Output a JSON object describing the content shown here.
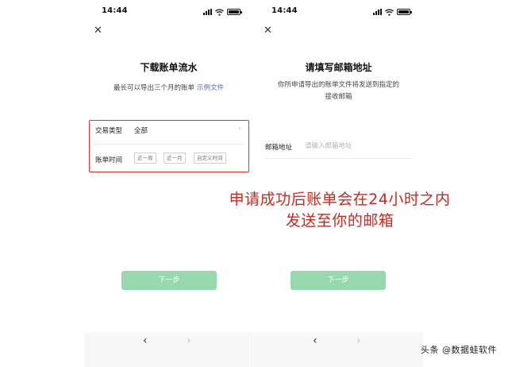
{
  "left_screen": {
    "status_time": "14:44",
    "title": "下载账单流水",
    "subtitle": "最长可以导出三个月的账单",
    "subtitle_link": "示例文件",
    "transaction_type_label": "交易类型",
    "transaction_type_value": "全部",
    "chevron": "›",
    "bill_time_label": "账单时间",
    "time_chips": [
      "近一周",
      "近一月",
      "自定义时间"
    ],
    "next_button": "下一步"
  },
  "right_screen": {
    "status_time": "14:44",
    "title": "请填写邮箱地址",
    "subtitle": "你所申请导出的账单文件将发送到指定的接收邮箱",
    "email_label": "邮箱地址",
    "email_placeholder": "请输入邮箱地址",
    "email_value": "",
    "next_button": "下一步"
  },
  "icons": {
    "close": "✕",
    "nav_back": "‹",
    "nav_forward": "›"
  },
  "annotation": {
    "line1": "申请成功后账单会在24小时之内",
    "line2": "发送至你的邮箱"
  },
  "watermark": "头条 @数据蛙软件",
  "colors": {
    "annotation_red": "#c62b22",
    "highlight_border": "#d8342c",
    "button_green_disabled": "#95d9ad",
    "link_blue": "#576b95"
  }
}
